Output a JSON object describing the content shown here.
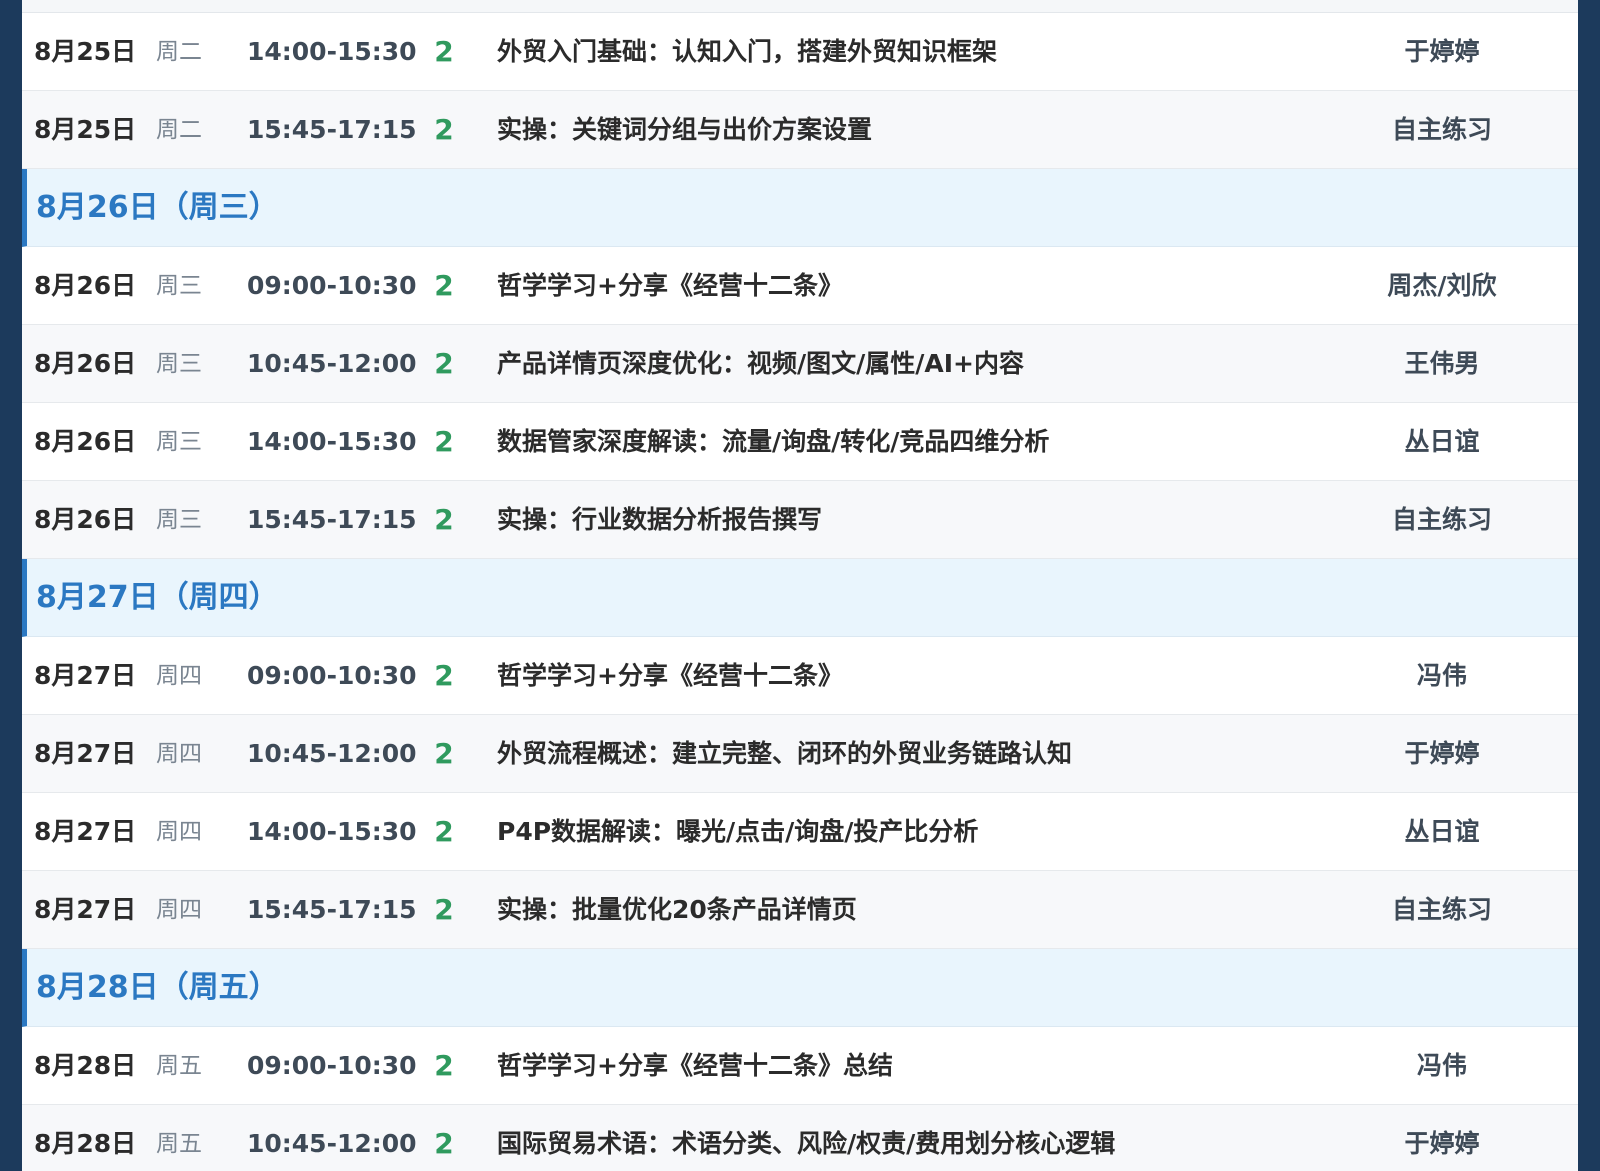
{
  "schedule": {
    "rows": [
      {
        "kind": "class",
        "date": "8月25日",
        "weekday": "周二",
        "time": "14:00-15:30",
        "hours": "2",
        "topic": "外贸入门基础：认知入门，搭建外贸知识框架",
        "teacher": "于婷婷"
      },
      {
        "kind": "class",
        "date": "8月25日",
        "weekday": "周二",
        "time": "15:45-17:15",
        "hours": "2",
        "topic": "实操：关键词分组与出价方案设置",
        "teacher": "自主练习"
      },
      {
        "kind": "day",
        "title": "8月26日（周三）"
      },
      {
        "kind": "class",
        "date": "8月26日",
        "weekday": "周三",
        "time": "09:00-10:30",
        "hours": "2",
        "topic": "哲学学习+分享《经营十二条》",
        "teacher": "周杰/刘欣"
      },
      {
        "kind": "class",
        "date": "8月26日",
        "weekday": "周三",
        "time": "10:45-12:00",
        "hours": "2",
        "topic": "产品详情页深度优化：视频/图文/属性/AI+内容",
        "teacher": "王伟男"
      },
      {
        "kind": "class",
        "date": "8月26日",
        "weekday": "周三",
        "time": "14:00-15:30",
        "hours": "2",
        "topic": "数据管家深度解读：流量/询盘/转化/竞品四维分析",
        "teacher": "丛日谊"
      },
      {
        "kind": "class",
        "date": "8月26日",
        "weekday": "周三",
        "time": "15:45-17:15",
        "hours": "2",
        "topic": "实操：行业数据分析报告撰写",
        "teacher": "自主练习"
      },
      {
        "kind": "day",
        "title": "8月27日（周四）"
      },
      {
        "kind": "class",
        "date": "8月27日",
        "weekday": "周四",
        "time": "09:00-10:30",
        "hours": "2",
        "topic": "哲学学习+分享《经营十二条》",
        "teacher": "冯伟"
      },
      {
        "kind": "class",
        "date": "8月27日",
        "weekday": "周四",
        "time": "10:45-12:00",
        "hours": "2",
        "topic": "外贸流程概述：建立完整、闭环的外贸业务链路认知",
        "teacher": "于婷婷"
      },
      {
        "kind": "class",
        "date": "8月27日",
        "weekday": "周四",
        "time": "14:00-15:30",
        "hours": "2",
        "topic": "P4P数据解读：曝光/点击/询盘/投产比分析",
        "teacher": "丛日谊"
      },
      {
        "kind": "class",
        "date": "8月27日",
        "weekday": "周四",
        "time": "15:45-17:15",
        "hours": "2",
        "topic": "实操：批量优化20条产品详情页",
        "teacher": "自主练习"
      },
      {
        "kind": "day",
        "title": "8月28日（周五）"
      },
      {
        "kind": "class",
        "date": "8月28日",
        "weekday": "周五",
        "time": "09:00-10:30",
        "hours": "2",
        "topic": "哲学学习+分享《经营十二条》总结",
        "teacher": "冯伟"
      },
      {
        "kind": "class",
        "date": "8月28日",
        "weekday": "周五",
        "time": "10:45-12:00",
        "hours": "2",
        "topic": "国际贸易术语：术语分类、风险/权责/费用划分核心逻辑",
        "teacher": "于婷婷"
      }
    ]
  },
  "colors": {
    "page_border": "#1c3a5c",
    "day_header_bg": "#e9f5fd",
    "day_header_text": "#2b78c2",
    "hours_text": "#2f9a5e",
    "row_alt_bg": "#f7f8fa"
  }
}
